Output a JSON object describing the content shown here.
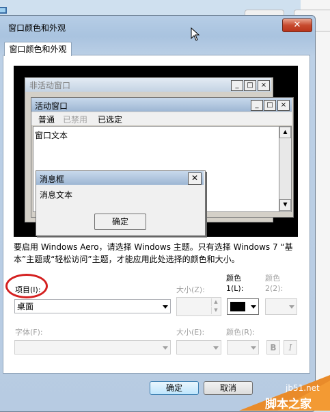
{
  "window": {
    "title": "窗口颜色和外观",
    "close_glyph": "✕"
  },
  "tab": {
    "label": "窗口颜色和外观"
  },
  "preview": {
    "inactive_title": "非活动窗口",
    "active_title": "活动窗口",
    "menu": {
      "normal": "普通",
      "disabled": "已禁用",
      "selected": "已选定"
    },
    "window_text": "窗口文本",
    "message_box": {
      "title": "消息框",
      "text": "消息文本",
      "ok": "确定",
      "close_glyph": "✕"
    },
    "caption_buttons": {
      "minimize": "_",
      "maximize": "□",
      "close": "×"
    }
  },
  "description": "要启用 Windows Aero，请选择 Windows 主题。只有选择 Windows 7 “基本”主题或“轻松访问”主题，才能应用此处选择的颜色和大小。",
  "item": {
    "label": "项目(I):",
    "value": "桌面"
  },
  "size1": {
    "label": "大小(Z):"
  },
  "color1": {
    "label_line1": "颜色",
    "label_line2": "1(L):",
    "value_color": "#000000"
  },
  "color2": {
    "label_line1": "颜色",
    "label_line2": "2(2):"
  },
  "font": {
    "label": "字体(F):"
  },
  "size2": {
    "label": "大小(E):"
  },
  "color3": {
    "label": "颜色(R):"
  },
  "bold_label": "B",
  "italic_label": "I",
  "buttons": {
    "ok": "确定",
    "cancel": "取消"
  },
  "watermark": {
    "site": "jb51.net",
    "name": "脚本之家"
  },
  "colors": {
    "highlight_circle": "#d42020"
  }
}
